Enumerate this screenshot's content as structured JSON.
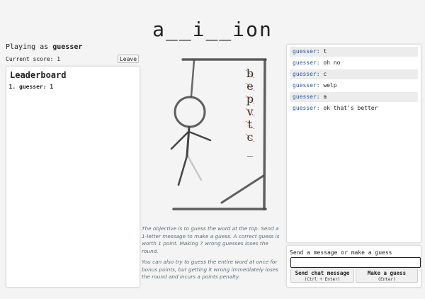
{
  "masked_word": "a__i__ion",
  "player": {
    "prefix": "Playing as",
    "name": "guesser"
  },
  "score": {
    "label": "Current score:",
    "value": "1"
  },
  "leave_label": "Leave",
  "leaderboard": {
    "title": "Leaderboard",
    "entries": [
      {
        "rank": "1.",
        "name": "guesser",
        "score": "1"
      }
    ]
  },
  "wrong_letters": [
    "b",
    "e",
    "p",
    "v",
    "t",
    "c",
    "_"
  ],
  "wrong_letter_color": "#d94545",
  "description": [
    "The objective is to guess the word at the top. Send a 1-letter message to make a guess. A correct guess is worth 1 point. Making 7 wrong guesses loses the round.",
    "You can also try to guess the entire word at once for bonus points, but getting it wrong immediately loses the round and incurs a points penalty."
  ],
  "chat": [
    {
      "user": "guesser",
      "text": "t"
    },
    {
      "user": "guesser",
      "text": "oh no"
    },
    {
      "user": "guesser",
      "text": "c"
    },
    {
      "user": "guesser",
      "text": "welp"
    },
    {
      "user": "guesser",
      "text": "a"
    },
    {
      "user": "guesser",
      "text": "ok that's better"
    }
  ],
  "composer": {
    "label": "Send a message or make a guess",
    "input_value": "",
    "send_label": "Send chat message",
    "send_shortcut": "(Ctrl + Enter)",
    "guess_label": "Make a guess",
    "guess_shortcut": "(Enter)"
  },
  "accent_color": "#1f5aa3"
}
